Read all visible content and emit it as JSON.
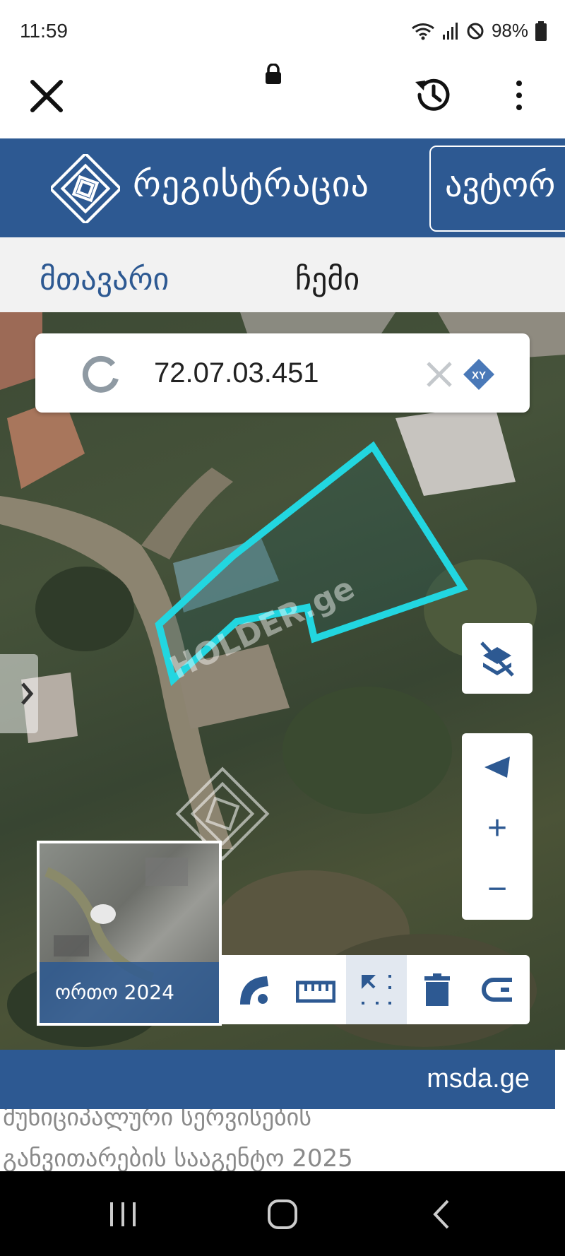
{
  "status_bar": {
    "time": "11:59",
    "battery": "98%"
  },
  "header": {
    "title": "რეგისტრაცია",
    "login_label": "ავტორ"
  },
  "nav": {
    "tabs": [
      "მთავარი",
      "ჩემი"
    ]
  },
  "search": {
    "value": "72.07.03.451",
    "xy_label": "XY"
  },
  "map": {
    "watermark": "HOLDER.ge",
    "minimap_label": "ორთო 2024",
    "zoom_in": "+",
    "zoom_out": "−",
    "parcel_color": "#22d6e0"
  },
  "footer": {
    "link": "msda.ge",
    "line1": "მუნიციპალური სერვისების",
    "line2": "განვითარების სააგენტო 2025"
  },
  "colors": {
    "brand": "#2d5992"
  }
}
